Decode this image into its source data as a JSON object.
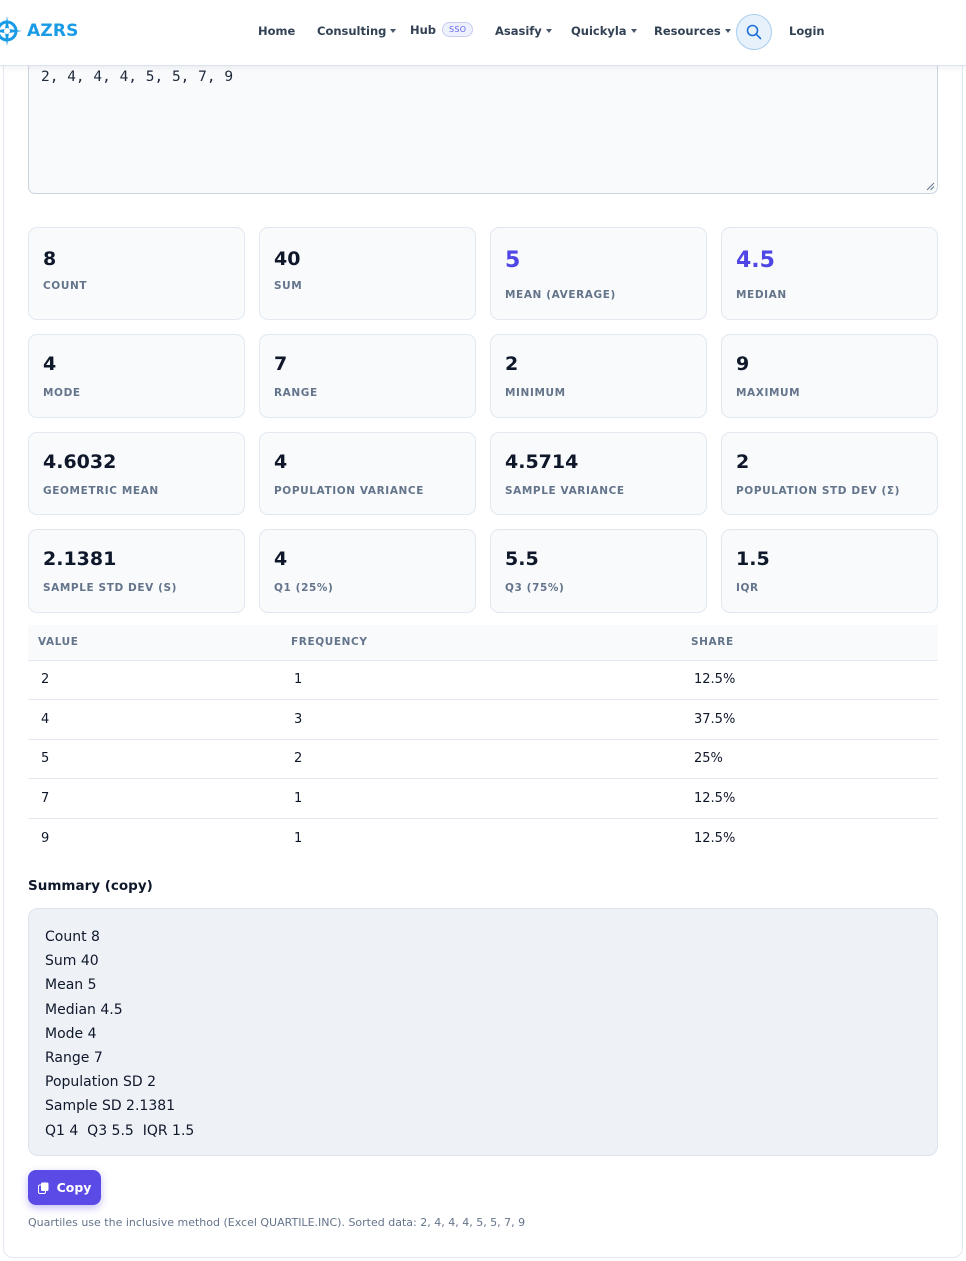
{
  "nav": {
    "brand": "AZRS",
    "items": [
      {
        "label": "Home",
        "dropdown": false
      },
      {
        "label": "Consulting",
        "dropdown": true
      },
      {
        "label": "Hub",
        "dropdown": false,
        "badge": "SSO"
      },
      {
        "label": "Asasify",
        "dropdown": true
      },
      {
        "label": "Quickyla",
        "dropdown": true
      },
      {
        "label": "Resources",
        "dropdown": true
      }
    ],
    "search_icon": "search-icon",
    "login": "Login"
  },
  "input": {
    "value": "2, 4, 4, 4, 5, 5, 7, 9"
  },
  "stats": [
    {
      "value": "8",
      "label": "COUNT"
    },
    {
      "value": "40",
      "label": "SUM"
    },
    {
      "value": "5",
      "label": "MEAN (AVERAGE)",
      "accent": true
    },
    {
      "value": "4.5",
      "label": "MEDIAN",
      "accent": true
    },
    {
      "value": "4",
      "label": "MODE"
    },
    {
      "value": "7",
      "label": "RANGE"
    },
    {
      "value": "2",
      "label": "MINIMUM"
    },
    {
      "value": "9",
      "label": "MAXIMUM"
    },
    {
      "value": "4.6032",
      "label": "GEOMETRIC MEAN"
    },
    {
      "value": "4",
      "label": "POPULATION VARIANCE"
    },
    {
      "value": "4.5714",
      "label": "SAMPLE VARIANCE"
    },
    {
      "value": "2",
      "label": "POPULATION STD DEV (Σ)"
    },
    {
      "value": "2.1381",
      "label": "SAMPLE STD DEV (S)"
    },
    {
      "value": "4",
      "label": "Q1 (25%)"
    },
    {
      "value": "5.5",
      "label": "Q3 (75%)"
    },
    {
      "value": "1.5",
      "label": "IQR"
    }
  ],
  "frequency_table": {
    "headers": [
      "VALUE",
      "FREQUENCY",
      "SHARE"
    ],
    "rows": [
      [
        "2",
        "1",
        "12.5%"
      ],
      [
        "4",
        "3",
        "37.5%"
      ],
      [
        "5",
        "2",
        "25%"
      ],
      [
        "7",
        "1",
        "12.5%"
      ],
      [
        "9",
        "1",
        "12.5%"
      ]
    ]
  },
  "summary": {
    "title": "Summary (copy)",
    "lines": [
      "Count 8",
      "Sum 40",
      "Mean 5",
      "Median 4.5",
      "Mode 4",
      "Range 7",
      "Population SD 2",
      "Sample SD 2.1381",
      "Q1 4  Q3 5.5  IQR 1.5"
    ]
  },
  "copy_button": {
    "label": "Copy",
    "icon": "copy-icon"
  },
  "footnote": "Quartiles use the inclusive method (Excel QUARTILE.INC). Sorted data: 2, 4, 4, 4, 5, 5, 7, 9",
  "colors": {
    "accent": "#4f46e5",
    "brand": "#1a9be6",
    "button": "#5b4be6"
  }
}
